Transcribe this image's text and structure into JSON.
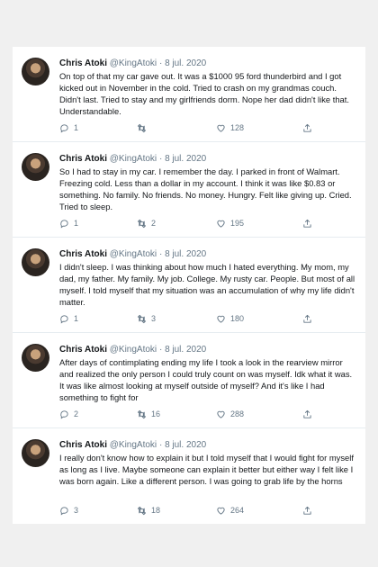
{
  "tweets": [
    {
      "name": "Chris Atoki",
      "handle": "@KingAtoki",
      "sep": "·",
      "date": "8 jul. 2020",
      "text": "On top of that my car gave out. It was a $1000 95 ford thunderbird and I got kicked out in November in the cold. Tried to crash on my grandmas couch. Didn't last. Tried to stay and my girlfriends dorm. Nope her dad didn't like that. Understandable.",
      "replies": "1",
      "retweets": "",
      "likes": "128"
    },
    {
      "name": "Chris Atoki",
      "handle": "@KingAtoki",
      "sep": "·",
      "date": "8 jul. 2020",
      "text": "So I had to stay in my car. I remember the day. I parked in front of Walmart. Freezing cold. Less than a dollar in my account. I think it was like $0.83 or something. No family. No friends. No money. Hungry. Felt like giving up. Cried. Tried to sleep.",
      "replies": "1",
      "retweets": "2",
      "likes": "195"
    },
    {
      "name": "Chris Atoki",
      "handle": "@KingAtoki",
      "sep": "·",
      "date": "8 jul. 2020",
      "text": "I didn't sleep. I was thinking about how much I hated everything. My mom, my dad, my father. My family. My job. College. My rusty car. People. But most of all myself. I told myself that my situation was an accumulation of why my life didn't matter.",
      "replies": "1",
      "retweets": "3",
      "likes": "180"
    },
    {
      "name": "Chris Atoki",
      "handle": "@KingAtoki",
      "sep": "·",
      "date": "8 jul. 2020",
      "text": "After days of contimplating ending my life I took a look in the rearview mirror and realized the only person I could truly count on was myself. Idk what it was. It was like almost looking at myself outside of myself? And it's like I had something to fight for",
      "replies": "2",
      "retweets": "16",
      "likes": "288"
    },
    {
      "name": "Chris Atoki",
      "handle": "@KingAtoki",
      "sep": "·",
      "date": "8 jul. 2020",
      "text": "I really don't know how to explain it but I told myself that I would fight for myself as long as I live. Maybe someone can explain it better but either way I felt like I was born again. Like a different person. I was going to grab life by the horns",
      "replies": "3",
      "retweets": "18",
      "likes": "264"
    }
  ],
  "icons": {
    "reply": "reply-icon",
    "retweet": "retweet-icon",
    "like": "heart-icon",
    "share": "share-icon"
  },
  "colors": {
    "text": "#14171a",
    "muted": "#657786",
    "divider": "#e6ecf0"
  }
}
